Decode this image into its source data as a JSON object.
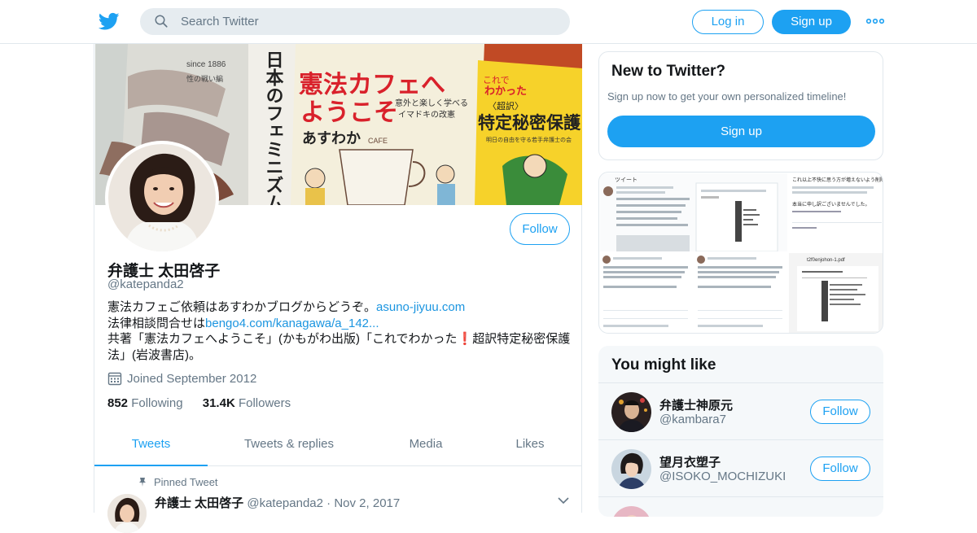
{
  "header": {
    "search_placeholder": "Search Twitter",
    "login_label": "Log in",
    "signup_label": "Sign up",
    "logo_icon": "twitter-bird-icon",
    "more_icon": "more-dots-icon"
  },
  "profile": {
    "name": "弁護士 太田啓子",
    "handle": "@katepanda2",
    "follow_label": "Follow",
    "bio": {
      "line1_text": "憲法カフェご依頼はあすわかブログからどうぞ。",
      "line1_link": "asuno-jiyuu.com",
      "line2_text": "法律相談問合せは",
      "line2_link": "bengo4.com/kanagawa/a_142...",
      "line3_pre": "共著「憲法カフェへようこそ」(かもがわ出版)「これでわかった",
      "line3_mark": "❗",
      "line3_post": "超訳特定秘密保護法」(岩波書店)。"
    },
    "joined": "Joined September 2012",
    "following_count": "852",
    "following_label": "Following",
    "followers_count": "31.4K",
    "followers_label": "Followers",
    "banner_texts": {
      "book1_small": "since 1886",
      "book1_sub": "性の戦い編",
      "book1_vertical": "日本のフェミニズム",
      "book2_title1": "憲法カフェへ",
      "book2_title2": "ようこそ",
      "book2_sub1": "意外と楽しく学べる",
      "book2_sub2": "イマドキの改憲",
      "book2_author": "あすわか",
      "book2_cafe": "CAFE",
      "book3_small": "これで",
      "book3_title": "わかった",
      "book3_tag": "〈超訳〉",
      "book3_main": "特定秘密保護",
      "book3_sub": "明日の自由を守る若手弁護士の会"
    }
  },
  "tabs": [
    {
      "label": "Tweets",
      "active": true
    },
    {
      "label": "Tweets & replies",
      "active": false
    },
    {
      "label": "Media",
      "active": false
    },
    {
      "label": "Likes",
      "active": false
    }
  ],
  "pinned_tweet": {
    "pinned_label": "Pinned Tweet",
    "author_name": "弁護士 太田啓子",
    "author_handle": "@katepanda2",
    "separator": "·",
    "date": "Nov 2, 2017"
  },
  "new_to_twitter": {
    "title": "New to Twitter?",
    "subtitle": "Sign up now to get your own personalized timeline!",
    "button_label": "Sign up"
  },
  "media_preview": {
    "thumb1_header": "ツイート",
    "thumb2_text": "これ以上不快に思う方が増えないよう削除、非公開させていただきます。",
    "thumb2_apology": "本当に申し訳ございませんでした。",
    "thumb5_title": "t2f0enjohon-1.pdf"
  },
  "you_might_like": {
    "title": "You might like",
    "users": [
      {
        "name": "弁護士神原元",
        "handle": "@kambara7",
        "follow_label": "Follow"
      },
      {
        "name": "望月衣塑子",
        "handle": "@ISOKO_MOCHIZUKI",
        "follow_label": "Follow"
      },
      {
        "name": "",
        "handle": "",
        "follow_label": ""
      }
    ]
  },
  "colors": {
    "accent": "#1da1f2",
    "link": "#1b95e0",
    "muted": "#657786",
    "text": "#14171a",
    "border": "#e1e8ed"
  }
}
